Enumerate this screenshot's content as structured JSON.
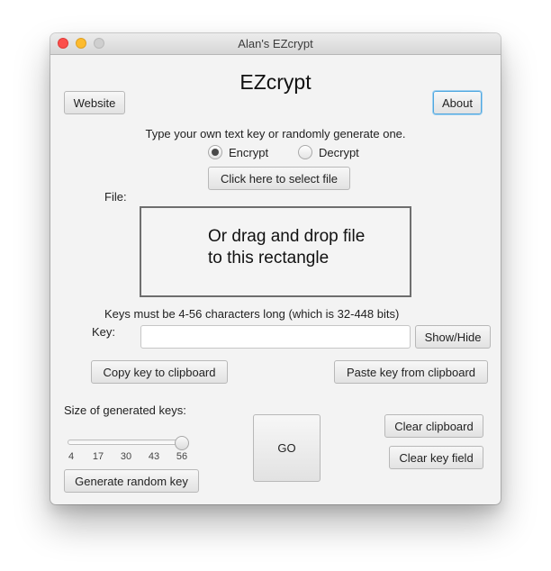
{
  "window": {
    "title": "Alan's EZcrypt"
  },
  "header": {
    "app_name": "EZcrypt",
    "website_label": "Website",
    "about_label": "About"
  },
  "instructions": "Type your own text key or randomly generate one.",
  "mode": {
    "options": [
      {
        "label": "Encrypt",
        "selected": true
      },
      {
        "label": "Decrypt",
        "selected": false
      }
    ]
  },
  "file": {
    "select_label": "Click here to select file",
    "file_label": "File:",
    "dropzone_line1": "Or drag and drop file",
    "dropzone_line2": "to this rectangle"
  },
  "key": {
    "requirements": "Keys must be 4-56 characters long (which is 32-448 bits)",
    "label": "Key:",
    "value": "",
    "placeholder": "",
    "show_hide_label": "Show/Hide",
    "copy_label": "Copy key to clipboard",
    "paste_label": "Paste key from clipboard"
  },
  "generator": {
    "size_label": "Size of generated keys:",
    "slider_min": 4,
    "slider_max": 56,
    "slider_value": 56,
    "ticks": [
      "4",
      "17",
      "30",
      "43",
      "56"
    ],
    "generate_label": "Generate random key"
  },
  "actions": {
    "go_label": "GO",
    "clear_clipboard_label": "Clear clipboard",
    "clear_key_label": "Clear key field"
  }
}
